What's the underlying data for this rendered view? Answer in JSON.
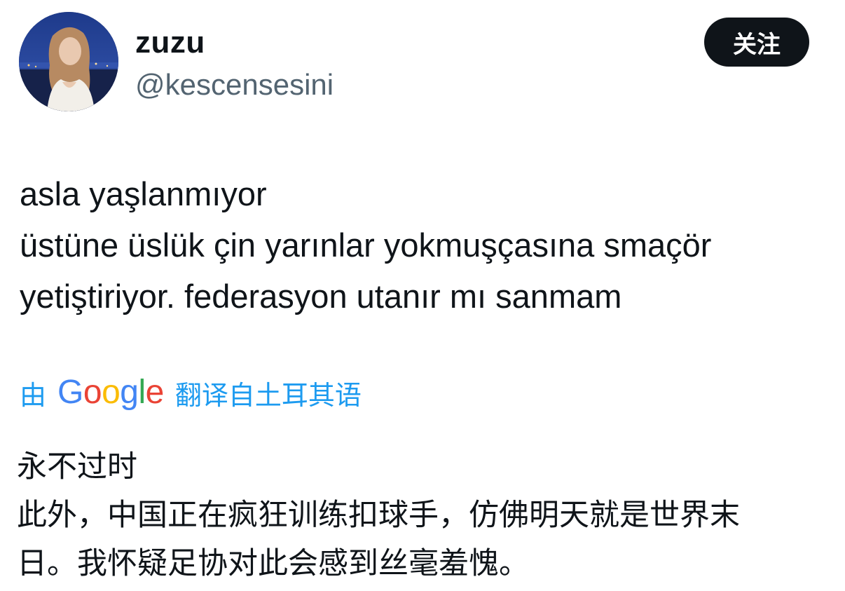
{
  "user": {
    "display_name": "zuzu",
    "handle": "@kescensesini",
    "avatar_icon": "profile-photo"
  },
  "follow_button": {
    "label": "关注"
  },
  "tweet": {
    "lines": [
      "asla yaşlanmıyor",
      "üstüne üslük çin yarınlar yokmuşçasına smaçör",
      "yetiştiriyor. federasyon utanır mı sanmam"
    ]
  },
  "translation": {
    "prefix": "由",
    "logo_text": "Google",
    "suffix": "翻译自土耳其语",
    "link_color": "#1d9bf0",
    "lines": [
      "永不过时",
      "此外，中国正在疯狂训练扣球手，仿佛明天就是世界末",
      "日。我怀疑足协对此会感到丝毫羞愧。"
    ]
  },
  "colors": {
    "text_primary": "#0f1419",
    "text_secondary": "#536471",
    "button_bg": "#0f1419",
    "button_text": "#ffffff",
    "google_blue": "#4285f4",
    "google_red": "#ea4335",
    "google_yellow": "#fbbc05",
    "google_green": "#34a853"
  }
}
